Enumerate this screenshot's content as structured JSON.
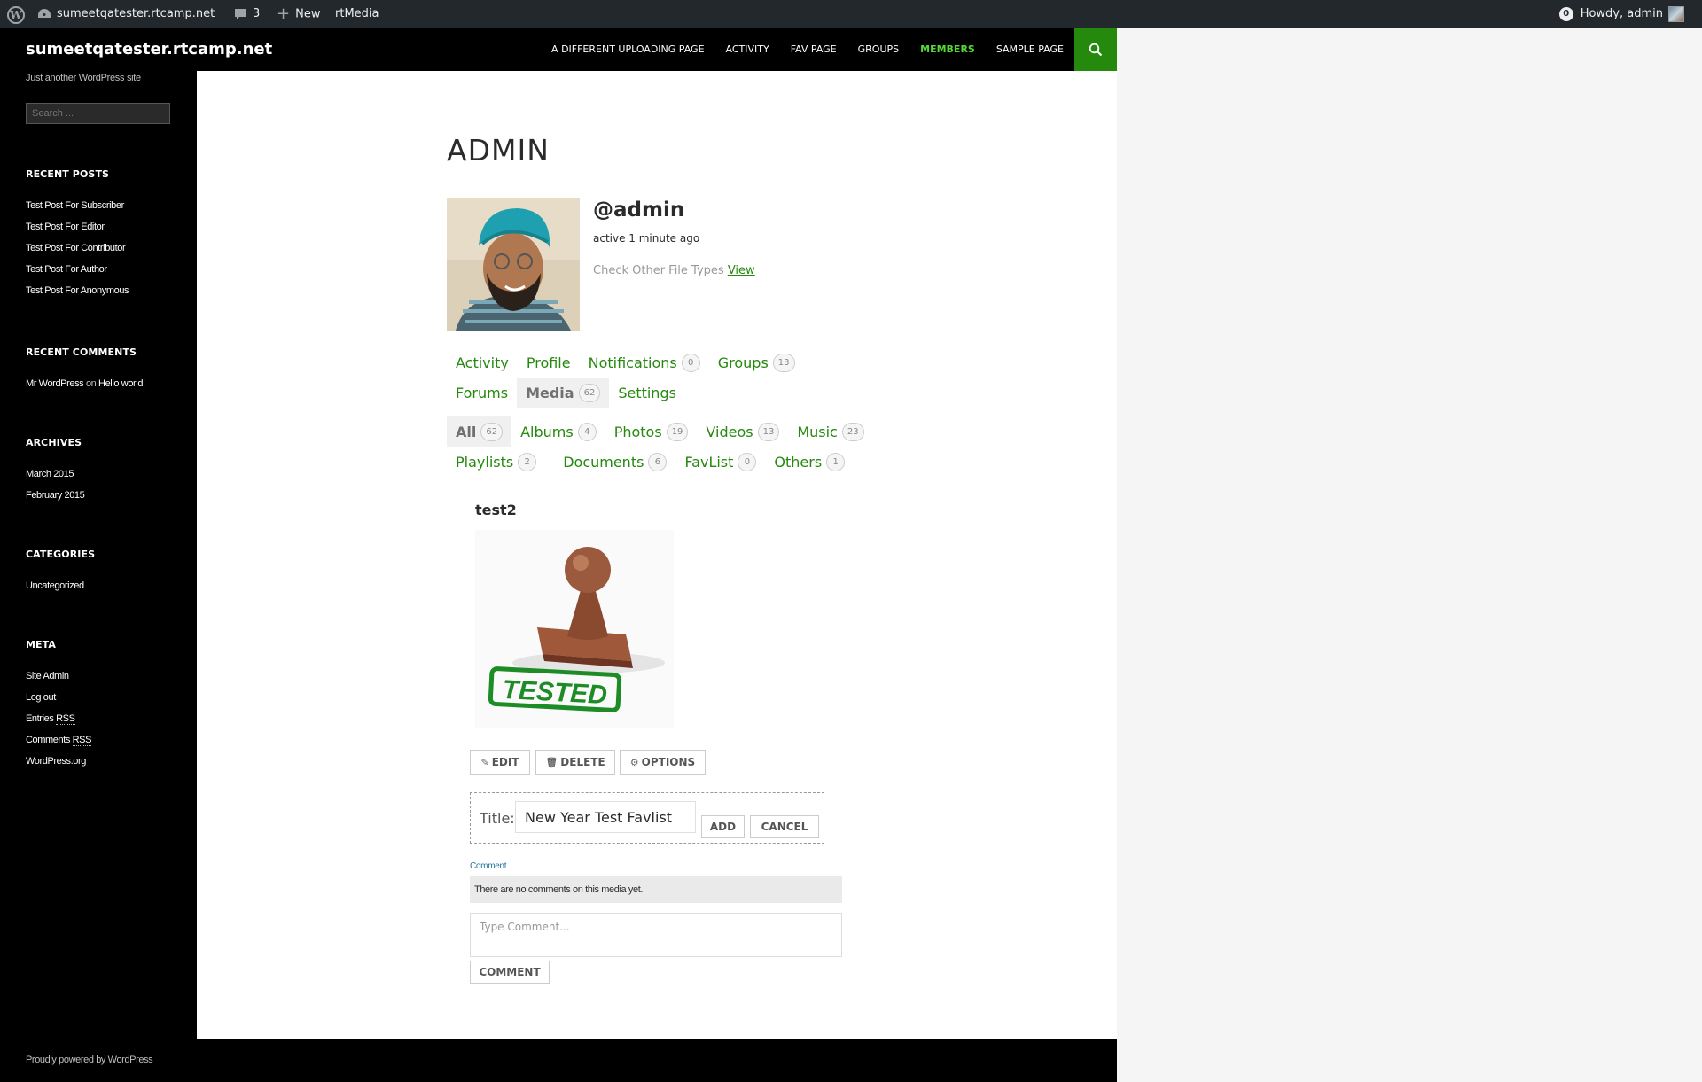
{
  "adminbar": {
    "site_name": "sumeetqatester.rtcamp.net",
    "comments_count": "3",
    "new_label": "New",
    "rtmedia_label": "rtMedia",
    "notifications_count": "0",
    "howdy": "Howdy, admin"
  },
  "header": {
    "site_title": "sumeetqatester.rtcamp.net",
    "nav": [
      {
        "label": "A DIFFERENT UPLOADING PAGE"
      },
      {
        "label": "ACTIVITY"
      },
      {
        "label": "FAV PAGE"
      },
      {
        "label": "GROUPS"
      },
      {
        "label": "MEMBERS"
      },
      {
        "label": "SAMPLE PAGE"
      }
    ]
  },
  "sidebar": {
    "description": "Just another WordPress site",
    "search_placeholder": "Search ...",
    "recent_posts": {
      "title": "RECENT POSTS",
      "items": [
        "Test Post For Subscriber",
        "Test Post For Editor",
        "Test Post For Contributor",
        "Test Post For Author",
        "Test Post For Anonymous"
      ]
    },
    "recent_comments": {
      "title": "RECENT COMMENTS",
      "author": "Mr WordPress",
      "on": "on",
      "post": "Hello world!"
    },
    "archives": {
      "title": "ARCHIVES",
      "items": [
        "March 2015",
        "February 2015"
      ]
    },
    "categories": {
      "title": "CATEGORIES",
      "items": [
        "Uncategorized"
      ]
    },
    "meta": {
      "title": "META",
      "site_admin": "Site Admin",
      "logout": "Log out",
      "entries": "Entries",
      "comments": "Comments",
      "rss": "RSS",
      "wordpress_org": "WordPress.org"
    }
  },
  "profile": {
    "page_title": "ADMIN",
    "handle": "@admin",
    "activity": "active 1 minute ago",
    "file_types_text": "Check Other File Types",
    "file_types_link": "View"
  },
  "member_nav": {
    "activity": "Activity",
    "profile": "Profile",
    "notifications": "Notifications",
    "notifications_count": "0",
    "groups": "Groups",
    "groups_count": "13",
    "forums": "Forums",
    "media": "Media",
    "media_count": "62",
    "settings": "Settings"
  },
  "media_nav": {
    "all": "All",
    "all_count": "62",
    "albums": "Albums",
    "albums_count": "4",
    "photos": "Photos",
    "photos_count": "19",
    "videos": "Videos",
    "videos_count": "13",
    "music": "Music",
    "music_count": "23",
    "playlists": "Playlists",
    "playlists_count": "2",
    "documents": "Documents",
    "documents_count": "6",
    "favlist": "FavList",
    "favlist_count": "0",
    "others": "Others",
    "others_count": "1"
  },
  "media": {
    "title": "test2",
    "stamp_text": "TESTED",
    "edit": "EDIT",
    "delete": "DELETE",
    "options": "OPTIONS"
  },
  "favlist_form": {
    "label": "Title:",
    "value": "New Year Test Favlist",
    "add": "ADD",
    "cancel": "CANCEL"
  },
  "comments": {
    "link": "Comment",
    "empty": "There are no comments on this media yet.",
    "placeholder": "Type Comment...",
    "submit": "COMMENT"
  },
  "footer": {
    "text": "Proudly powered by WordPress"
  },
  "colors": {
    "accent": "#24890d",
    "accent_light": "#55d737",
    "adminbar": "#23282d",
    "dark": "#000000"
  }
}
